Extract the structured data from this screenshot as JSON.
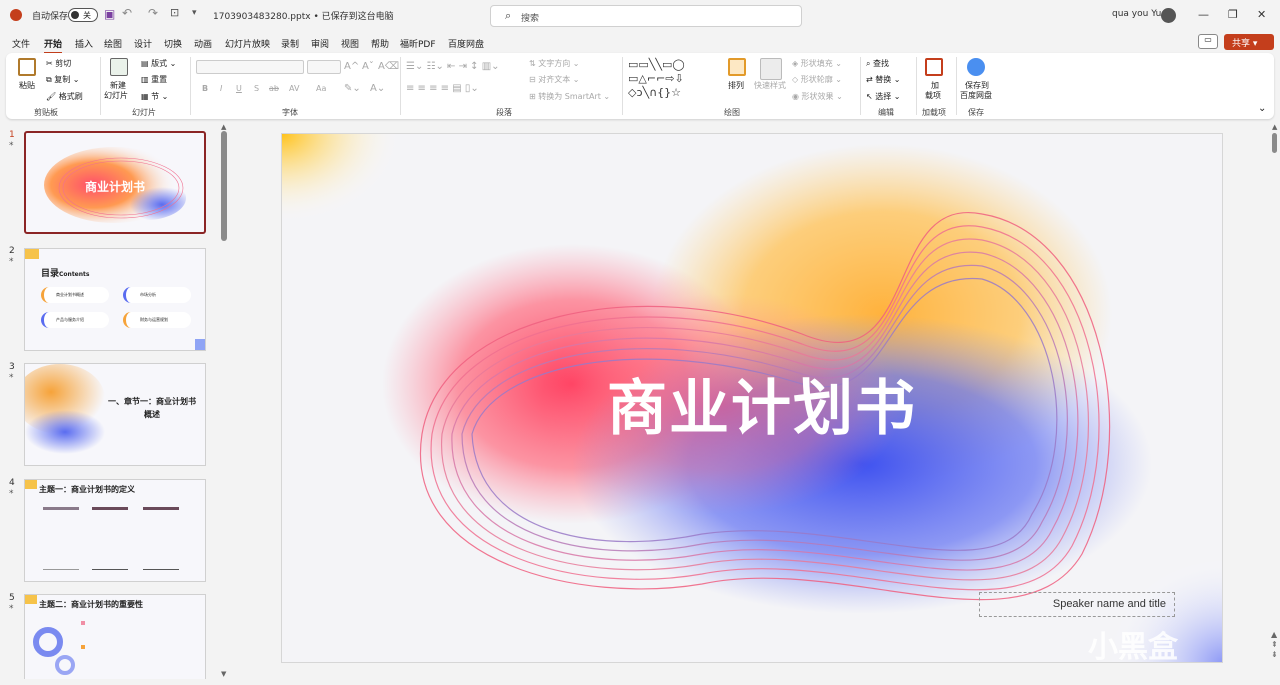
{
  "titlebar": {
    "autosave_label": "自动保存",
    "autosave_state": "关",
    "filename": "1703903483280.pptx • 已保存到这台电脑",
    "search_placeholder": "搜索",
    "user_name": "qua you Yu"
  },
  "menu": {
    "tabs": [
      "文件",
      "开始",
      "插入",
      "绘图",
      "设计",
      "切换",
      "动画",
      "幻灯片放映",
      "录制",
      "审阅",
      "视图",
      "帮助",
      "福昕PDF",
      "百度网盘"
    ],
    "active": "开始",
    "share_label": "共享"
  },
  "ribbon": {
    "clipboard": {
      "paste": "粘贴",
      "cut": "剪切",
      "copy": "复制",
      "format_painter": "格式刷",
      "label": "剪贴板"
    },
    "slides": {
      "new_slide_1": "新建",
      "new_slide_2": "幻灯片",
      "layout": "版式",
      "reset": "重置",
      "section": "节",
      "label": "幻灯片"
    },
    "font": {
      "label": "字体",
      "bold": "B",
      "italic": "I",
      "underline": "U",
      "shadow": "S",
      "strike": "ab",
      "spacing": "AV",
      "case": "Aa"
    },
    "paragraph": {
      "label": "段落",
      "text_direction": "文字方向",
      "align_text": "对齐文本",
      "smartart": "转换为 SmartArt"
    },
    "drawing": {
      "label": "绘图",
      "arrange": "排列",
      "quick_styles": "快速样式",
      "shape_fill": "形状填充",
      "shape_outline": "形状轮廓",
      "shape_effects": "形状效果"
    },
    "editing": {
      "label": "编辑",
      "find": "查找",
      "replace": "替换",
      "select": "选择"
    },
    "addins": {
      "label": "加载项",
      "btn_1": "加",
      "btn_2": "载项"
    },
    "save": {
      "label": "保存",
      "btn_1": "保存到",
      "btn_2": "百度网盘"
    }
  },
  "thumbnails": [
    {
      "num": "1",
      "title": "商业计划书"
    },
    {
      "num": "2",
      "title": "目录",
      "subtitle": "Contents",
      "items": [
        "商业计划书概述",
        "市场分析",
        "产品与服务介绍",
        "财务与运营规划"
      ]
    },
    {
      "num": "3",
      "title": "一、章节一：商业计划书",
      "title2": "概述"
    },
    {
      "num": "4",
      "title": "主题一：商业计划书的定义"
    },
    {
      "num": "5",
      "title": "主题二：商业计划书的重要性"
    }
  ],
  "slide": {
    "title": "商业计划书",
    "speaker": "Speaker name and title"
  },
  "watermark": "小黑盒",
  "colors": {
    "accent": "#c43e1c",
    "selected_border": "#8b2525"
  }
}
